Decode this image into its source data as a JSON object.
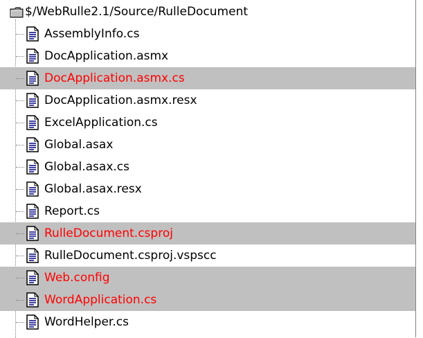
{
  "tree": {
    "root": {
      "label": "$/WebRulle2.1/Source/RulleDocument",
      "icon": "folder-icon"
    },
    "items": [
      {
        "label": "AssemblyInfo.cs",
        "icon": "document-icon",
        "highlighted": false
      },
      {
        "label": "DocApplication.asmx",
        "icon": "document-icon",
        "highlighted": false
      },
      {
        "label": "DocApplication.asmx.cs",
        "icon": "document-icon",
        "highlighted": true
      },
      {
        "label": "DocApplication.asmx.resx",
        "icon": "document-icon",
        "highlighted": false
      },
      {
        "label": "ExcelApplication.cs",
        "icon": "document-icon",
        "highlighted": false
      },
      {
        "label": "Global.asax",
        "icon": "document-icon",
        "highlighted": false
      },
      {
        "label": "Global.asax.cs",
        "icon": "document-icon",
        "highlighted": false
      },
      {
        "label": "Global.asax.resx",
        "icon": "document-icon",
        "highlighted": false
      },
      {
        "label": "Report.cs",
        "icon": "document-icon",
        "highlighted": false
      },
      {
        "label": "RulleDocument.csproj",
        "icon": "document-icon",
        "highlighted": true
      },
      {
        "label": "RulleDocument.csproj.vspscc",
        "icon": "document-icon",
        "highlighted": false
      },
      {
        "label": "Web.config",
        "icon": "document-icon",
        "highlighted": true
      },
      {
        "label": "WordApplication.cs",
        "icon": "document-icon",
        "highlighted": true
      },
      {
        "label": "WordHelper.cs",
        "icon": "document-icon",
        "highlighted": false
      }
    ]
  },
  "colors": {
    "highlight_background": "#c0c0c0",
    "highlight_text": "#ff0000",
    "normal_text": "#000000"
  }
}
